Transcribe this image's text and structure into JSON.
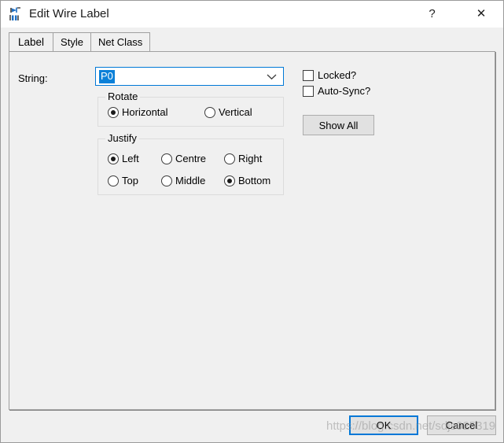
{
  "window": {
    "title": "Edit Wire Label",
    "icon": "wire-label-icon",
    "help_label": "?",
    "close_label": "✕"
  },
  "tabs": [
    {
      "label": "Label",
      "active": true
    },
    {
      "label": "Style",
      "active": false
    },
    {
      "label": "Net Class",
      "active": false
    }
  ],
  "form": {
    "string_label": "String:",
    "string_value": "P0",
    "string_placeholder": "",
    "dropdown_icon": "chevron-down-icon"
  },
  "rotate": {
    "title": "Rotate",
    "options": [
      {
        "label": "Horizontal",
        "checked": true
      },
      {
        "label": "Vertical",
        "checked": false
      }
    ]
  },
  "justify": {
    "title": "Justify",
    "options": [
      {
        "label": "Left",
        "checked": true
      },
      {
        "label": "Centre",
        "checked": false
      },
      {
        "label": "Right",
        "checked": false
      },
      {
        "label": "Top",
        "checked": false
      },
      {
        "label": "Middle",
        "checked": false
      },
      {
        "label": "Bottom",
        "checked": true
      }
    ]
  },
  "options": {
    "locked": {
      "label": "Locked?",
      "checked": false
    },
    "auto_sync": {
      "label": "Auto-Sync?",
      "checked": false
    },
    "show_all_label": "Show All"
  },
  "footer": {
    "ok_label": "OK",
    "cancel_label": "Cancel"
  },
  "watermark": {
    "text": "https://blog.csdn.net/sdjs025319"
  },
  "colors": {
    "accent": "#0078d7",
    "selection": "#0a80d8",
    "dialog_bg": "#f0f0f0",
    "titlebar_bg": "#ffffff",
    "button_bg": "#e1e1e1",
    "border": "#a0a0a0"
  }
}
